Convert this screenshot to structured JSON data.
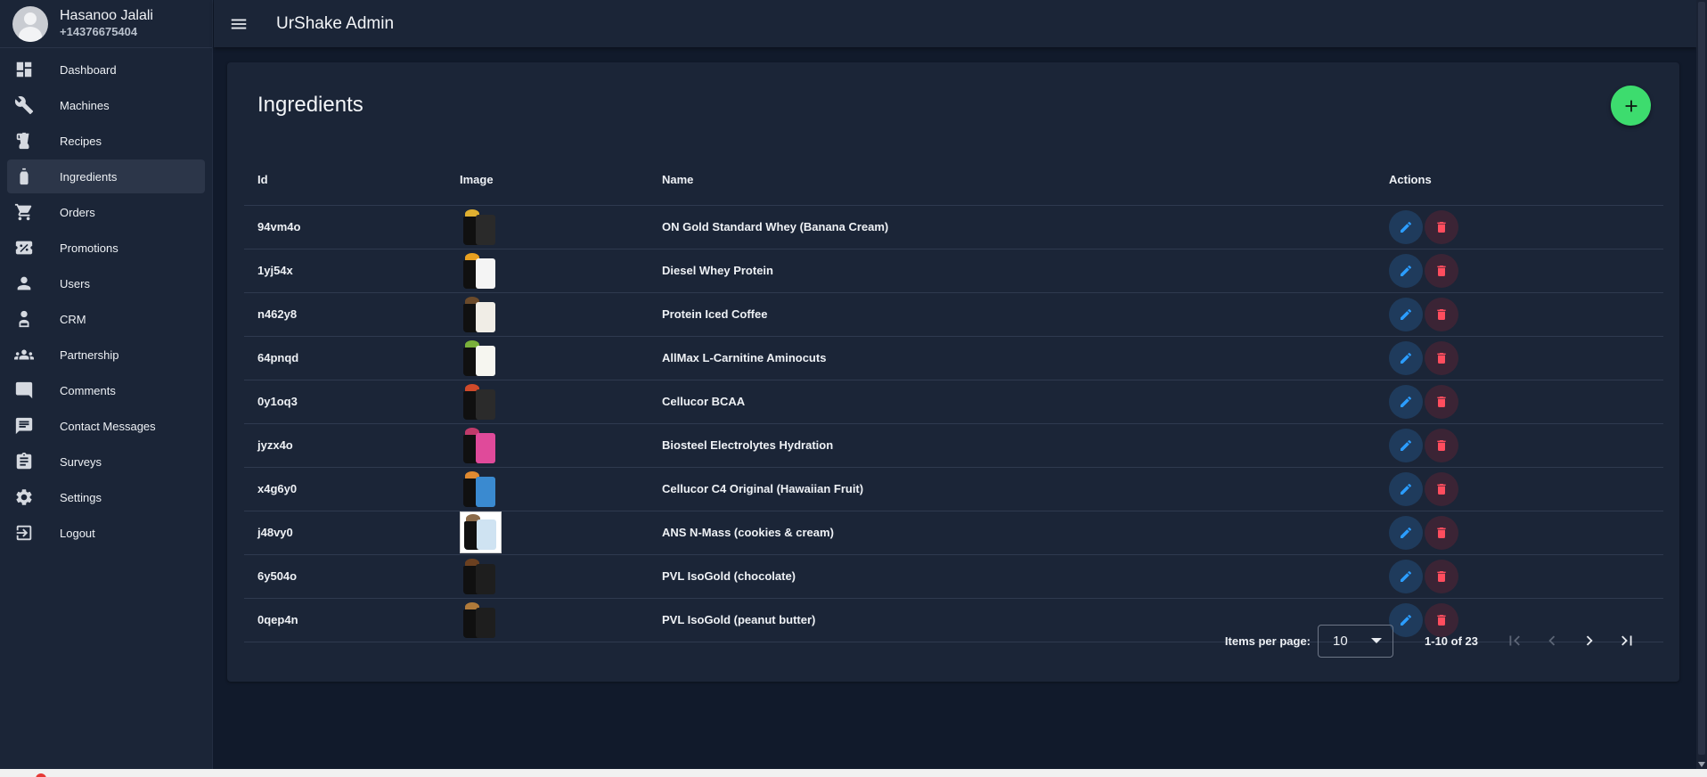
{
  "user": {
    "name": "Hasanoo Jalali",
    "phone": "+14376675404"
  },
  "app": {
    "title": "UrShake Admin"
  },
  "nav": [
    {
      "label": "Dashboard",
      "icon": "dashboard-icon"
    },
    {
      "label": "Machines",
      "icon": "wrench-icon"
    },
    {
      "label": "Recipes",
      "icon": "blender-icon"
    },
    {
      "label": "Ingredients",
      "icon": "bottle-icon",
      "active": true
    },
    {
      "label": "Orders",
      "icon": "cart-icon"
    },
    {
      "label": "Promotions",
      "icon": "discount-icon"
    },
    {
      "label": "Users",
      "icon": "person-icon"
    },
    {
      "label": "CRM",
      "icon": "crm-icon"
    },
    {
      "label": "Partnership",
      "icon": "group-icon"
    },
    {
      "label": "Comments",
      "icon": "comment-icon"
    },
    {
      "label": "Contact Messages",
      "icon": "message-icon"
    },
    {
      "label": "Surveys",
      "icon": "clipboard-icon"
    },
    {
      "label": "Settings",
      "icon": "gear-icon"
    },
    {
      "label": "Logout",
      "icon": "logout-icon"
    }
  ],
  "page": {
    "title": "Ingredients"
  },
  "table": {
    "headers": {
      "id": "Id",
      "image": "Image",
      "name": "Name",
      "actions": "Actions"
    },
    "rows": [
      {
        "id": "94vm4o",
        "name": "ON Gold Standard Whey (Banana Cream)",
        "tub_color": "#2a2a2a",
        "top_color": "#e0b030"
      },
      {
        "id": "1yj54x",
        "name": "Diesel Whey Protein",
        "tub_color": "#f4f4f4",
        "top_color": "#e8a020"
      },
      {
        "id": "n462y8",
        "name": "Protein Iced Coffee",
        "tub_color": "#f0ede6",
        "top_color": "#6b4a2a"
      },
      {
        "id": "64pnqd",
        "name": "AllMax L-Carnitine Aminocuts",
        "tub_color": "#f6f6f0",
        "top_color": "#7ab03a"
      },
      {
        "id": "0y1oq3",
        "name": "Cellucor BCAA",
        "tub_color": "#2b2b2b",
        "top_color": "#d04a2a"
      },
      {
        "id": "jyzx4o",
        "name": "Biosteel Electrolytes Hydration",
        "tub_color": "#e04a9a",
        "top_color": "#c03a6a"
      },
      {
        "id": "x4g6y0",
        "name": "Cellucor C4 Original (Hawaiian Fruit)",
        "tub_color": "#3a8ad0",
        "top_color": "#e08a30"
      },
      {
        "id": "j48vy0",
        "name": "ANS N-Mass (cookies & cream)",
        "tub_color": "#cfe3f2",
        "top_color": "#8a6a4a",
        "framed": true
      },
      {
        "id": "6y504o",
        "name": "PVL IsoGold (chocolate)",
        "tub_color": "#1e1e1e",
        "top_color": "#6b4020"
      },
      {
        "id": "0qep4n",
        "name": "PVL IsoGold (peanut butter)",
        "tub_color": "#1e1e1e",
        "top_color": "#b07a3a"
      }
    ]
  },
  "pagination": {
    "items_label": "Items per page:",
    "per_page": "10",
    "range": "1-10 of 23"
  },
  "colors": {
    "background": "#111a2b",
    "surface": "#1b2537",
    "accent_add": "#3ddc6e",
    "edit": "#2b9dff",
    "delete": "#ff4d5e"
  }
}
